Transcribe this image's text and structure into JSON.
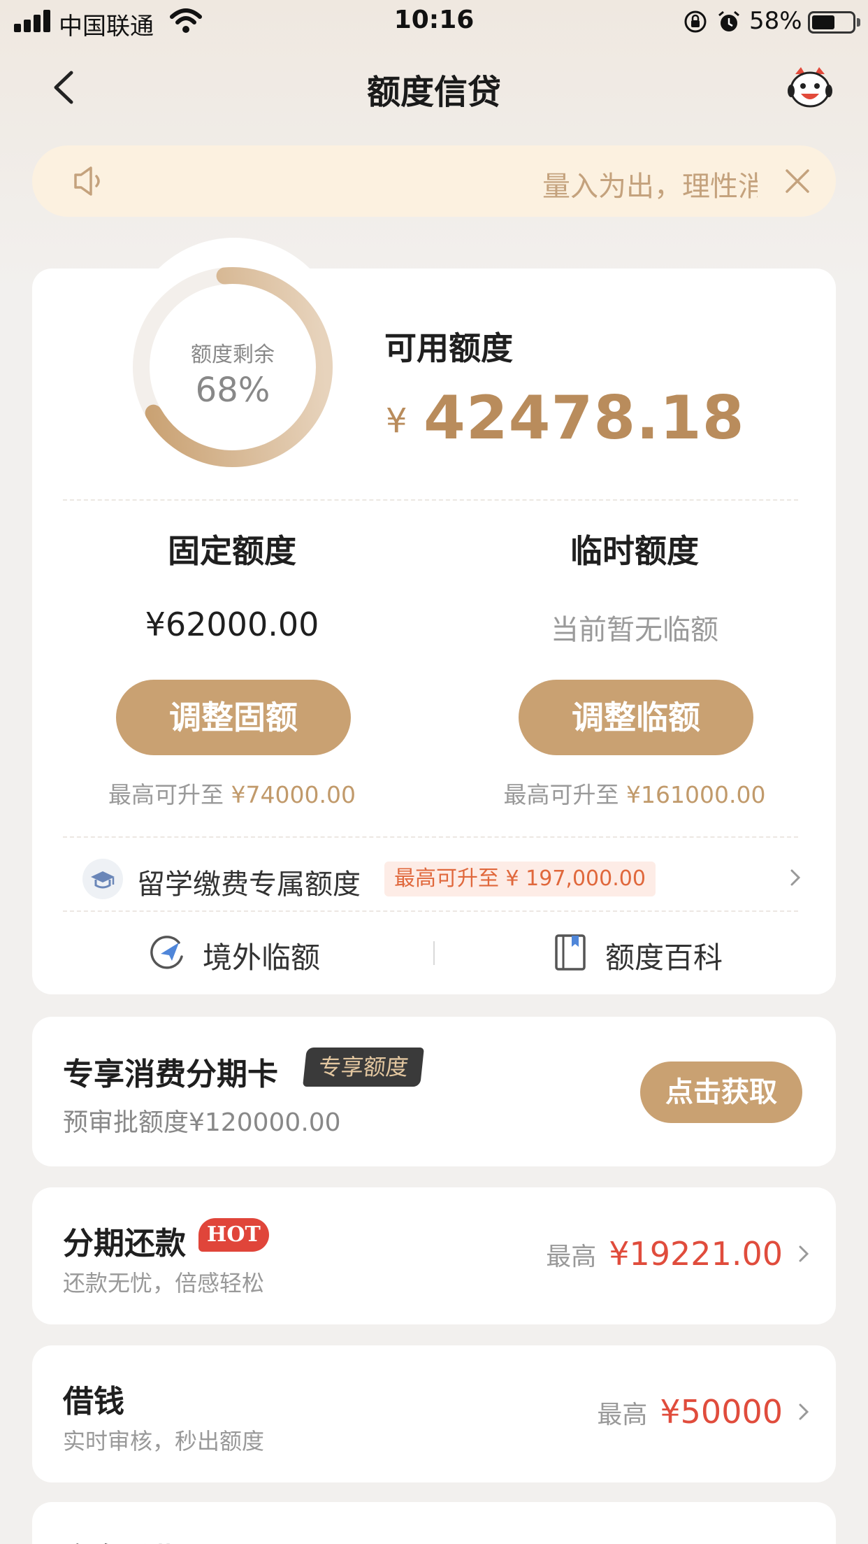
{
  "status_bar": {
    "carrier": "中国联通",
    "time": "10:16",
    "battery_percent": "58%",
    "battery_level": 0.58
  },
  "nav": {
    "title": "额度信贷",
    "back_icon": "chevron-left-icon",
    "mascot_icon": "mascot-icon"
  },
  "notice": {
    "text": "量入为出，理性消费",
    "speaker_icon": "speaker-icon",
    "close_icon": "close-icon"
  },
  "credit": {
    "ring_label": "额度剩余",
    "ring_percent_text": "68%",
    "ring_fraction": 0.68,
    "available_label": "可用额度",
    "currency_symbol": "¥",
    "available_amount": "42478.18",
    "fixed": {
      "title": "固定额度",
      "value": "¥62000.00",
      "button": "调整固额",
      "hint_prefix": "最高可升至",
      "hint_value": "¥74000.00"
    },
    "temporary": {
      "title": "临时额度",
      "value": "当前暂无临额",
      "button": "调整临额",
      "hint_prefix": "最高可升至",
      "hint_value": "¥161000.00"
    },
    "study": {
      "label": "留学缴费专属额度",
      "tag": "最高可升至 ¥ 197,000.00"
    },
    "links": {
      "overseas": "境外临额",
      "encyclopedia": "额度百科"
    }
  },
  "installment_card": {
    "title": "专享消费分期卡",
    "tag": "专享额度",
    "subtitle": "预审批额度¥120000.00",
    "button": "点击获取"
  },
  "list": [
    {
      "title": "分期还款",
      "badge": "HOT",
      "subtitle": "还款无忧，倍感轻松",
      "prefix": "最高",
      "value": "¥19221.00"
    },
    {
      "title": "借钱",
      "subtitle": "实时审核，秒出额度",
      "prefix": "最高",
      "value": "¥50000"
    }
  ],
  "partial_card": {
    "title": "汽车分期"
  },
  "colors": {
    "gold": "#c9a172",
    "amount_gold": "#b98c5c",
    "red": "#e04c3c",
    "notice_bg": "#fcf1e0"
  }
}
